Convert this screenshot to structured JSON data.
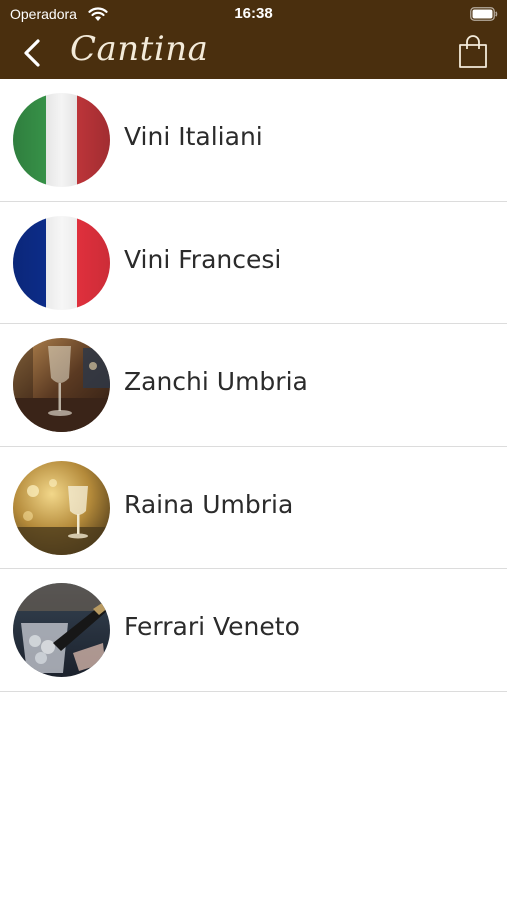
{
  "status_bar": {
    "carrier": "Operadora",
    "time": "16:38"
  },
  "nav": {
    "title": "Cantina",
    "back_icon": "chevron-left-icon",
    "cart_icon": "shopping-bag-icon"
  },
  "colors": {
    "header_bg": "#4a2f0e",
    "title_color": "#f3ead9",
    "label_color": "#2b2b2b",
    "divider": "#dcdcdc"
  },
  "items": [
    {
      "label": "Vini Italiani",
      "image": "italian-flag"
    },
    {
      "label": "Vini Francesi",
      "image": "french-flag"
    },
    {
      "label": "Zanchi Umbria",
      "image": "wine-glass-photo"
    },
    {
      "label": "Raina Umbria",
      "image": "restaurant-wine-photo"
    },
    {
      "label": "Ferrari Veneto",
      "image": "champagne-bucket-photo"
    }
  ]
}
